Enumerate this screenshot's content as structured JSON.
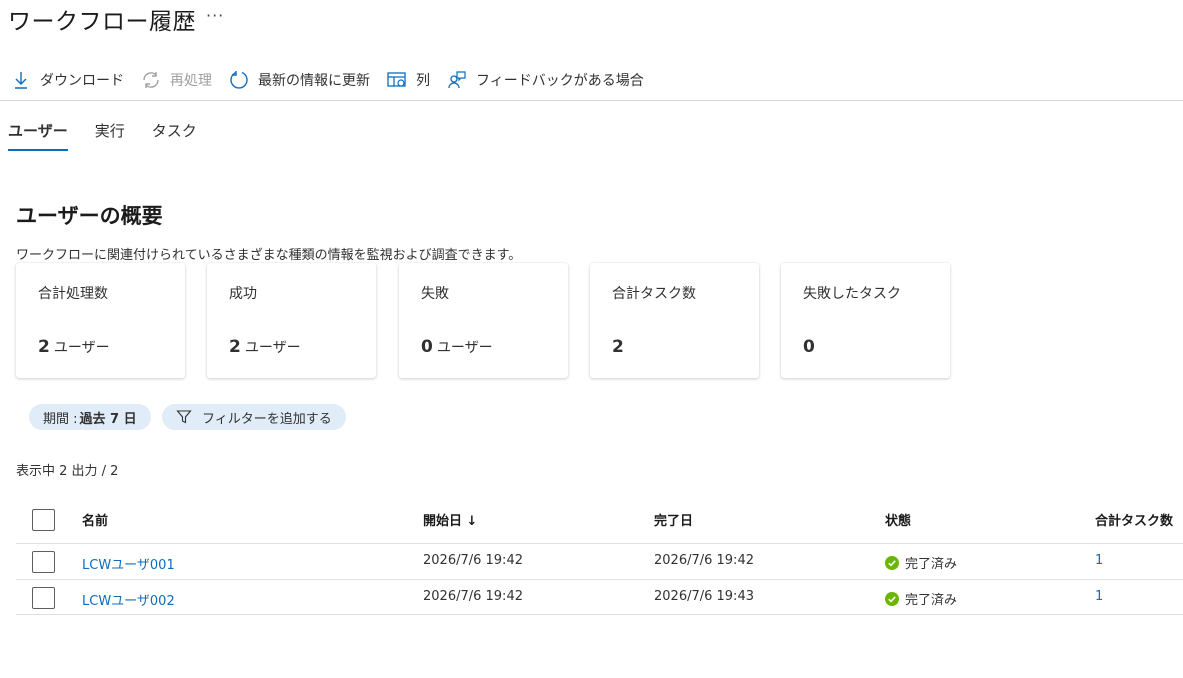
{
  "page": {
    "title": "ワークフロー履歴",
    "more_label": "···"
  },
  "toolbar": {
    "download": {
      "label": "ダウンロード",
      "icon": "download-icon"
    },
    "reprocess": {
      "label": "再処理",
      "icon": "refresh-icon",
      "disabled": true
    },
    "refresh": {
      "label": "最新の情報に更新",
      "icon": "refresh-icon"
    },
    "columns": {
      "label": "列",
      "icon": "columns-icon"
    },
    "feedback": {
      "label": "フィードバックがある場合",
      "icon": "feedback-icon"
    }
  },
  "tabs": [
    {
      "label": "ユーザー",
      "active": true
    },
    {
      "label": "実行",
      "active": false
    },
    {
      "label": "タスク",
      "active": false
    }
  ],
  "overview": {
    "title": "ユーザーの概要",
    "description": "ワークフローに関連付けられているさまざまな種類の情報を監視および調査できます。"
  },
  "cards": [
    {
      "label": "合計処理数",
      "value": "2",
      "unit": "ユーザー"
    },
    {
      "label": "成功",
      "value": "2",
      "unit": "ユーザー"
    },
    {
      "label": "失敗",
      "value": "0",
      "unit": "ユーザー"
    },
    {
      "label": "合計タスク数",
      "value": "2",
      "unit": ""
    },
    {
      "label": "失敗したタスク",
      "value": "0",
      "unit": ""
    }
  ],
  "filters": {
    "period_label": "期間 :",
    "period_value": "過去 7 日",
    "add_filter_label": "フィルターを追加する"
  },
  "results_count": "表示中 2 出力 / 2",
  "table": {
    "headers": {
      "name": "名前",
      "start": "開始日 ↓",
      "end": "完了日",
      "status": "状態",
      "tasks": "合計タスク数"
    },
    "rows": [
      {
        "name": "LCWユーザ001",
        "start": "2026/7/6 19:42",
        "end": "2026/7/6 19:42",
        "status": "完了済み",
        "tasks": "1"
      },
      {
        "name": "LCWユーザ002",
        "start": "2026/7/6 19:42",
        "end": "2026/7/6 19:43",
        "status": "完了済み",
        "tasks": "1"
      }
    ]
  },
  "colors": {
    "accent": "#0f6cbd",
    "success": "#6bb700",
    "pill_bg": "#e0ecf8"
  }
}
